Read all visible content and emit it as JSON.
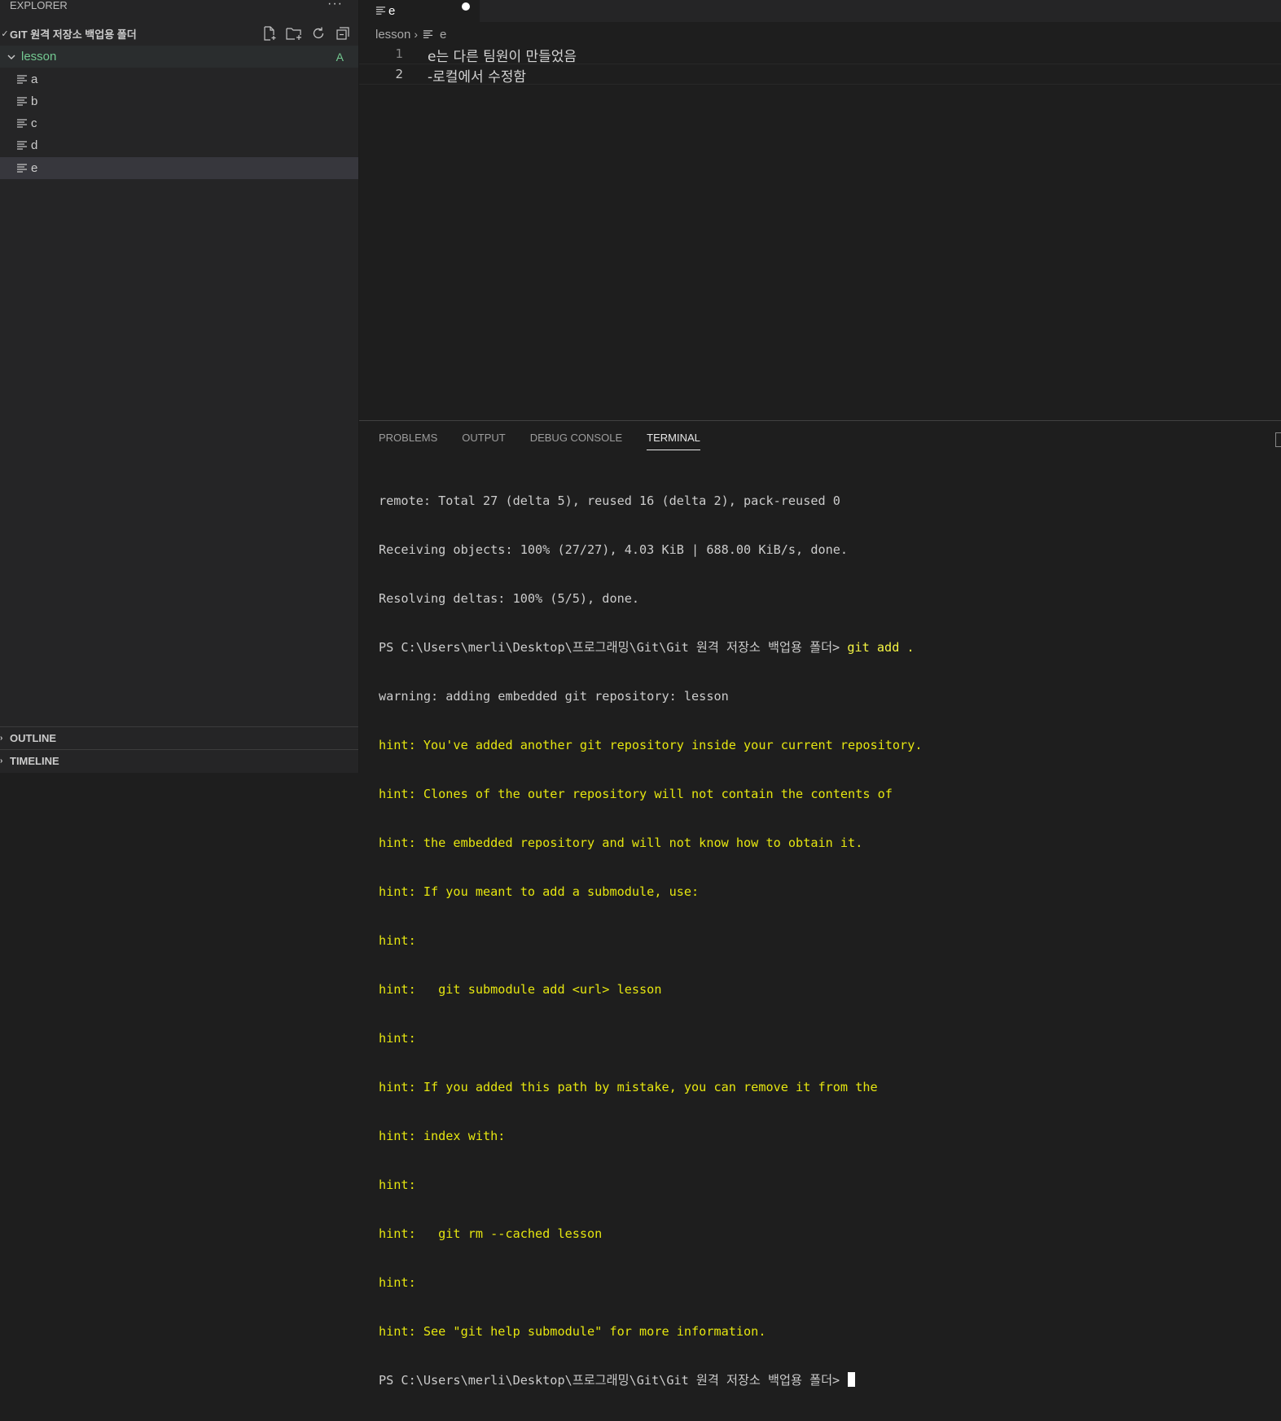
{
  "sidebar": {
    "title": "EXPLORER",
    "more": "···",
    "folder": "GIT 원격 저장소 백업용 폴더",
    "lesson": {
      "label": "lesson",
      "badge": "A"
    },
    "files": [
      "a",
      "b",
      "c",
      "d",
      "e"
    ],
    "sections": [
      "OUTLINE",
      "TIMELINE"
    ]
  },
  "editor": {
    "tab": "e",
    "breadcrumb": [
      "lesson",
      "e"
    ],
    "lines": [
      {
        "n": "1",
        "text": "e는 다른 팀원이 만들었음"
      },
      {
        "n": "2",
        "text": "-로컬에서 수정함"
      }
    ]
  },
  "panel": {
    "tabs": [
      "PROBLEMS",
      "OUTPUT",
      "DEBUG CONSOLE",
      "TERMINAL"
    ],
    "terminal": {
      "pre": [
        "remote: Total 27 (delta 5), reused 16 (delta 2), pack-reused 0",
        "Receiving objects: 100% (27/27), 4.03 KiB | 688.00 KiB/s, done.",
        "Resolving deltas: 100% (5/5), done."
      ],
      "prompt": "PS C:\\Users\\merli\\Desktop\\프로그래밍\\Git\\Git 원격 저장소 백업용 폴더> ",
      "command": "git add .",
      "warning": "warning: adding embedded git repository: lesson",
      "hints": [
        "hint: You've added another git repository inside your current repository.",
        "hint: Clones of the outer repository will not contain the contents of",
        "hint: the embedded repository and will not know how to obtain it.",
        "hint: If you meant to add a submodule, use:",
        "hint:",
        "hint:   git submodule add <url> lesson",
        "hint:",
        "hint: If you added this path by mistake, you can remove it from the",
        "hint: index with:",
        "hint:",
        "hint:   git rm --cached lesson",
        "hint:",
        "hint: See \"git help submodule\" for more information."
      ],
      "final_prompt": "PS C:\\Users\\merli\\Desktop\\프로그래밍\\Git\\Git 원격 저장소 백업용 폴더> "
    }
  }
}
